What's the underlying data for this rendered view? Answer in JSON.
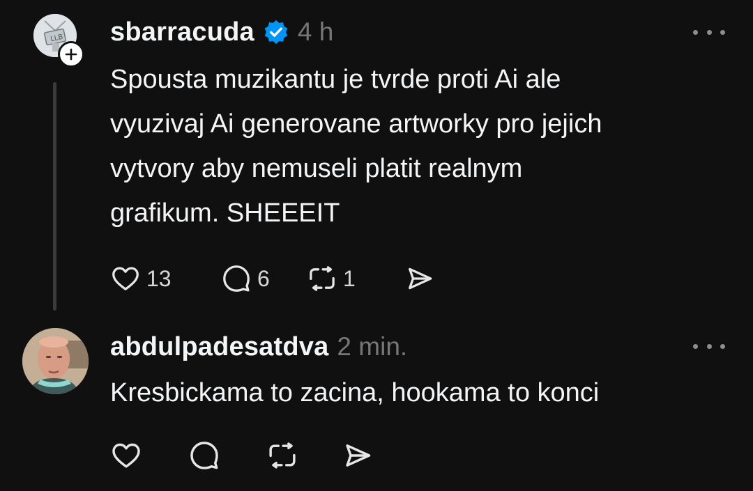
{
  "posts": [
    {
      "username": "sbarracuda",
      "verified": true,
      "timestamp": "4 h",
      "text": "Spousta muzikantu je tvrde proti Ai ale\nvyuzivaj Ai generovane artworky pro jejich\nvytvory aby nemuseli platit realnym\ngrafikum. SHEEEIT",
      "likes": "13",
      "replies": "6",
      "reposts": "1",
      "icons": [
        "heart-icon",
        "comment-icon",
        "repost-icon",
        "share-icon"
      ]
    },
    {
      "username": "abdulpadesatdva",
      "timestamp": "2 min.",
      "text": "Kresbickama to zacina, hookama to konci",
      "icons": [
        "heart-icon",
        "comment-icon",
        "repost-icon",
        "share-icon"
      ]
    }
  ],
  "colors": {
    "background": "#101010",
    "text": "#f3f5f7",
    "muted": "#777777",
    "verified_badge": "#0095f6",
    "thread_line": "#3b3b3b"
  }
}
